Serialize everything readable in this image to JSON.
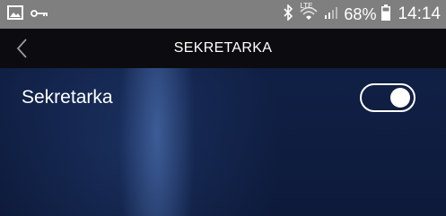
{
  "status_bar": {
    "left_icons": [
      "image-icon",
      "key-icon"
    ],
    "right_icons": [
      "bluetooth-icon",
      "lte-icon",
      "wifi-icon",
      "signal-icon",
      "battery-icon"
    ],
    "lte_label": "LTE",
    "battery_percent": "68%",
    "time": "14:14"
  },
  "header": {
    "title": "SEKRETARKA",
    "back_icon": "chevron-left-icon"
  },
  "setting": {
    "label": "Sekretarka",
    "enabled": true
  },
  "colors": {
    "status_bar": "#7f7f7f",
    "header": "#0c0c10",
    "background": "#101f44",
    "text": "#ffffff"
  }
}
